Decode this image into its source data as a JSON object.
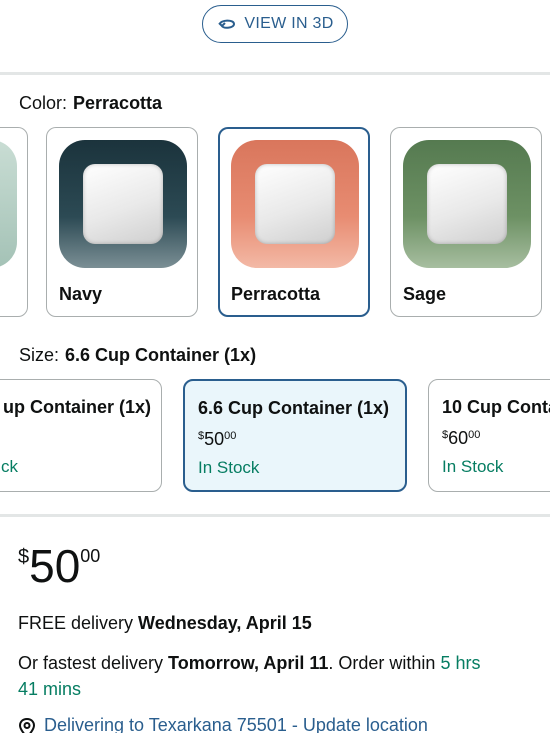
{
  "view3d": {
    "label": "VIEW IN 3D"
  },
  "color": {
    "label": "Color:",
    "selected": "Perracotta",
    "swatches": [
      {
        "name": "",
        "outer": "#b6d0c6"
      },
      {
        "name": "Navy",
        "outer": "#1e3a44"
      },
      {
        "name": "Perracotta",
        "outer": "#e07e64"
      },
      {
        "name": "Sage",
        "outer": "#5e8458"
      }
    ]
  },
  "size": {
    "label": "Size:",
    "selected": "6.6 Cup Container (1x)",
    "options": [
      {
        "title": "up Container (1x)",
        "price_dollars": "",
        "price_cents": "",
        "stock": "ck"
      },
      {
        "title": "6.6 Cup Container (1x)",
        "price_dollars": "50",
        "price_cents": "00",
        "stock": "In Stock"
      },
      {
        "title": "10 Cup Conta",
        "price_dollars": "60",
        "price_cents": "00",
        "stock": "In Stock"
      }
    ]
  },
  "price": {
    "currency": "$",
    "whole": "50",
    "fraction": "00"
  },
  "delivery": {
    "free_prefix": "FREE delivery ",
    "free_date": "Wednesday, April 15",
    "fast_prefix": "Or fastest delivery ",
    "fast_date": "Tomorrow, April 11",
    "order_within_prefix": ". Order within ",
    "order_within_a": "5 hrs",
    "order_within_b": "41 mins"
  },
  "location": {
    "text": "Delivering to Texarkana 75501 - Update location"
  }
}
